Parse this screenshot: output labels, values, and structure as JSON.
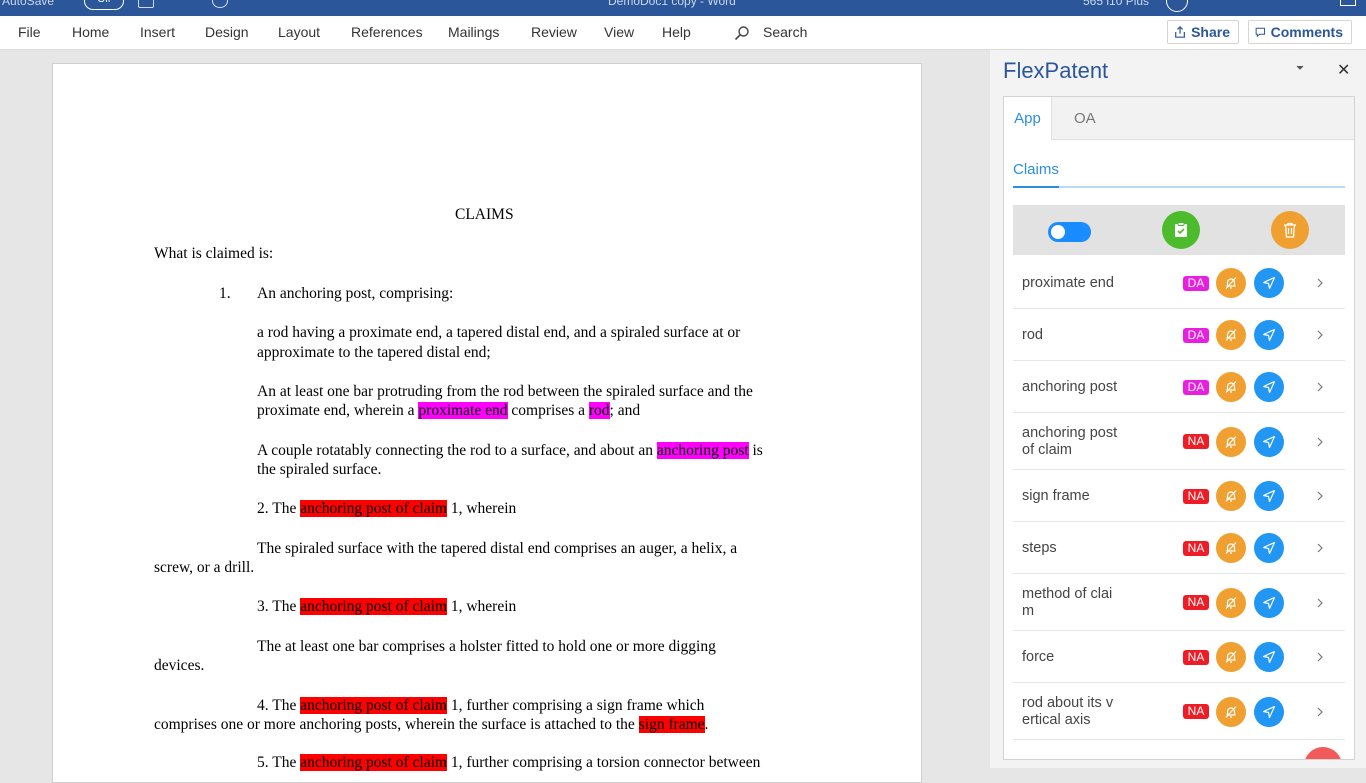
{
  "titlebar": {
    "autosave": "AutoSave",
    "toggle": "Off",
    "doc_title": "DemoDoc1 copy  -  Word",
    "user": "565 i10 Plus"
  },
  "ribbon": {
    "tabs": [
      "File",
      "Home",
      "Insert",
      "Design",
      "Layout",
      "References",
      "Mailings",
      "Review",
      "View",
      "Help"
    ],
    "search": "Search",
    "share": "Share",
    "comments": "Comments"
  },
  "document": {
    "heading": "CLAIMS",
    "intro": "What is claimed is:",
    "c1_num": "1.",
    "c1_head": "An anchoring post, comprising:",
    "c1_p1a": "a rod having a proximate end, a tapered distal end, and a spiraled surface at or",
    "c1_p1b": "approximate to the tapered distal end;",
    "c1_p2a": "An at least one bar protruding from the rod between the spiraled surface and the",
    "c1_p2b_pre": "proximate end, wherein a ",
    "c1_p2b_hl1": "proximate end",
    "c1_p2b_mid": " comprises a ",
    "c1_p2b_hl2": "rod",
    "c1_p2b_post": "; and",
    "c1_p3a_pre": "A couple rotatably connecting the rod to a surface, and about an ",
    "c1_p3a_hl": "anchoring post",
    "c1_p3a_post": " is",
    "c1_p3b": "the spiraled surface.",
    "c2_pre": "2. The ",
    "c2_hl": "anchoring post of claim",
    "c2_post": " 1, wherein",
    "c2_b1": "The spiraled surface with the tapered distal end comprises an auger, a helix, a",
    "c2_b2": "screw, or a drill.",
    "c3_pre": "3. The ",
    "c3_hl": "anchoring post of claim",
    "c3_post": " 1, wherein",
    "c3_b1": "The at least one bar comprises a holster fitted to hold one or more digging",
    "c3_b2": "devices.",
    "c4_pre": "4. The ",
    "c4_hl": "anchoring post of claim",
    "c4_post": " 1, further comprising a sign frame which",
    "c4_b_pre": "comprises one or more anchoring posts, wherein the surface is attached to the ",
    "c4_b_hl": "sign frame",
    "c4_b_post": ".",
    "c5_pre": "5. The ",
    "c5_hl": "anchoring post of claim",
    "c5_post": " 1, further comprising a torsion connector between"
  },
  "pane": {
    "title": "FlexPatent",
    "tabs": [
      "App",
      "OA"
    ],
    "subtab": "Claims",
    "colors": {
      "da": "#e81fe0",
      "na": "#ee1c25",
      "orange": "#f0a030",
      "blue": "#2196f3",
      "green": "#4cbb2c"
    },
    "terms": [
      {
        "lines": [
          "proximate end"
        ],
        "badge": "DA"
      },
      {
        "lines": [
          "rod"
        ],
        "badge": "DA"
      },
      {
        "lines": [
          "anchoring post"
        ],
        "badge": "DA"
      },
      {
        "lines": [
          "anchoring post",
          "of claim"
        ],
        "badge": "NA"
      },
      {
        "lines": [
          "sign frame"
        ],
        "badge": "NA"
      },
      {
        "lines": [
          "steps"
        ],
        "badge": "NA"
      },
      {
        "lines": [
          "method of clai",
          "m"
        ],
        "badge": "NA"
      },
      {
        "lines": [
          "force"
        ],
        "badge": "NA"
      },
      {
        "lines": [
          "rod about its v",
          "ertical axis"
        ],
        "badge": "NA"
      }
    ]
  }
}
